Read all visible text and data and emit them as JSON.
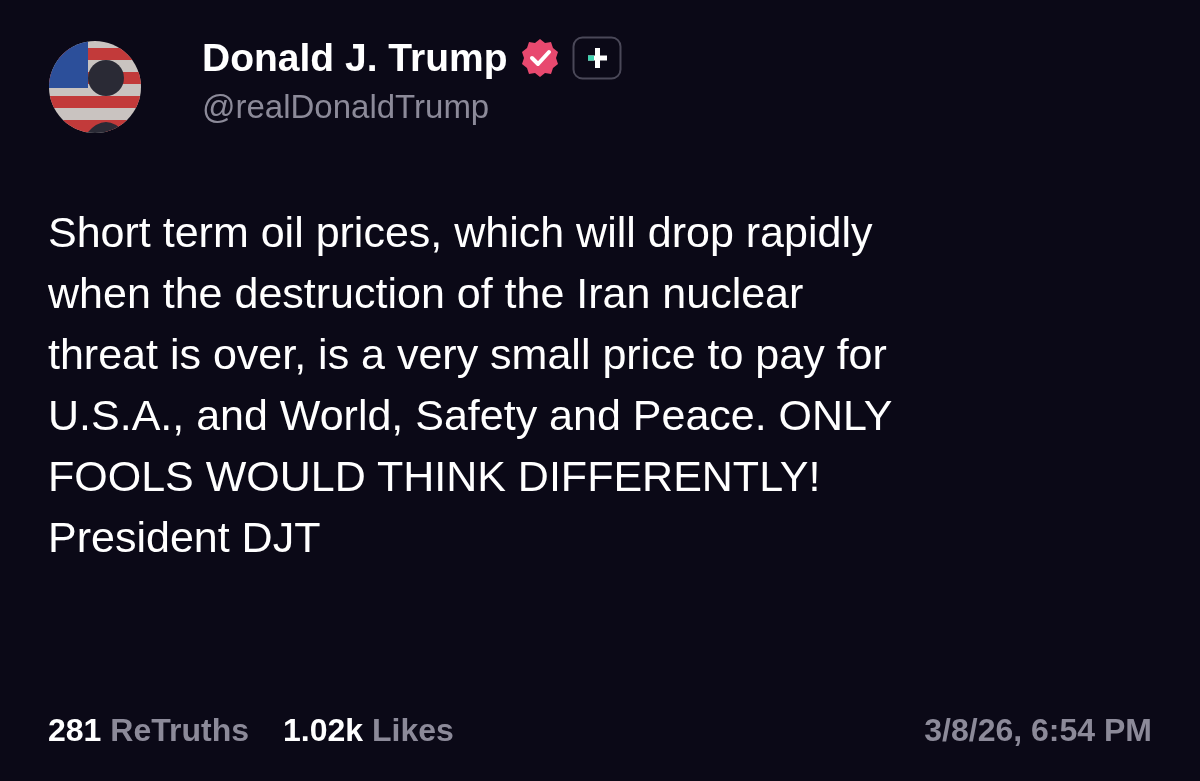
{
  "author": {
    "name": "Donald J. Trump",
    "verified": true,
    "handle": "@realDonaldTrump"
  },
  "post": {
    "text": "Short term oil prices, which will drop rapidly\nwhen the destruction of the Iran nuclear\nthreat is over, is a very small price to pay for\nU.S.A., and World, Safety and Peace. ONLY\nFOOLS WOULD THINK DIFFERENTLY!\nPresident DJT"
  },
  "stats": [
    {
      "count": "281",
      "label": "ReTruths"
    },
    {
      "count": "1.02k",
      "label": "Likes"
    }
  ],
  "timestamp": "3/8/26, 6:54 PM"
}
